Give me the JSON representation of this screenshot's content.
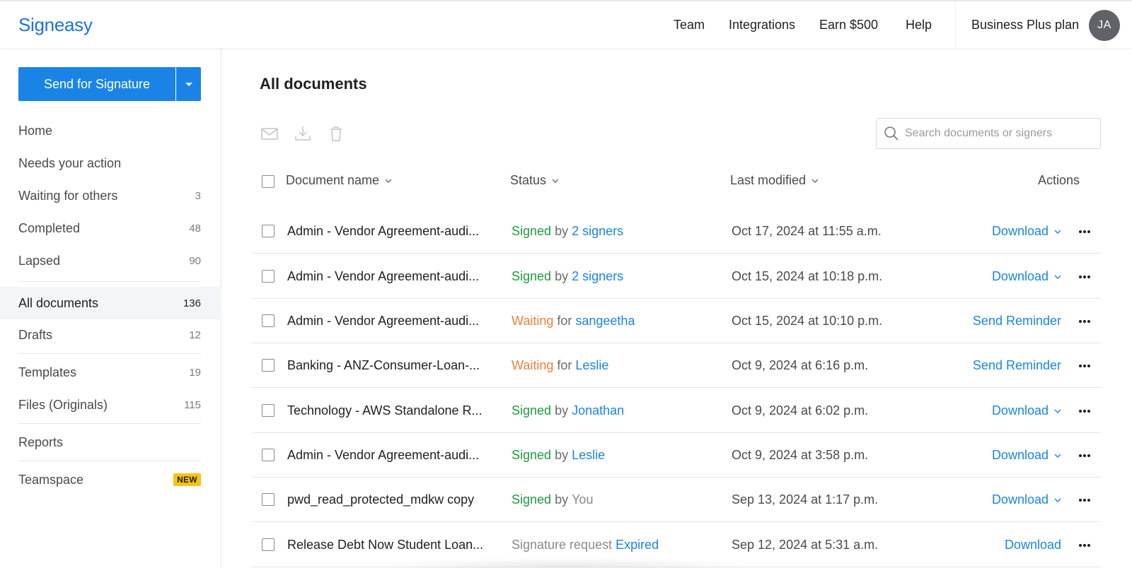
{
  "header": {
    "logo": "Signeasy",
    "nav": [
      {
        "label": "Team",
        "name": "nav-team"
      },
      {
        "label": "Integrations",
        "name": "nav-integrations"
      },
      {
        "label": "Earn $500",
        "name": "nav-earn"
      },
      {
        "label": "Help",
        "name": "nav-help"
      }
    ],
    "plan": "Business Plus plan",
    "avatar_initials": "JA"
  },
  "sidebar": {
    "send_label": "Send for Signature",
    "items": [
      {
        "label": "Home",
        "count": ""
      },
      {
        "label": "Needs your action",
        "count": ""
      },
      {
        "label": "Waiting for others",
        "count": "3"
      },
      {
        "label": "Completed",
        "count": "48"
      },
      {
        "label": "Lapsed",
        "count": "90"
      },
      {
        "label": "All documents",
        "count": "136",
        "active": true
      },
      {
        "label": "Drafts",
        "count": "12"
      },
      {
        "label": "Templates",
        "count": "19"
      },
      {
        "label": "Files (Originals)",
        "count": "115"
      },
      {
        "label": "Reports",
        "count": ""
      },
      {
        "label": "Teamspace",
        "badge": "NEW"
      }
    ]
  },
  "main": {
    "title": "All documents",
    "search_placeholder": "Search documents or signers",
    "columns": {
      "name": "Document name",
      "status": "Status",
      "modified": "Last modified",
      "actions": "Actions"
    },
    "rows": [
      {
        "name": "Admin - Vendor Agreement-audi...",
        "status_a": "Signed",
        "status_b": " by ",
        "status_c": "2 signers",
        "status_kind": "signed",
        "modified": "Oct 17, 2024 at 11:55 a.m.",
        "action": "Download",
        "action_menu": true
      },
      {
        "name": "Admin - Vendor Agreement-audi...",
        "status_a": "Signed",
        "status_b": " by ",
        "status_c": "2 signers",
        "status_kind": "signed",
        "modified": "Oct 15, 2024 at 10:18 p.m.",
        "action": "Download",
        "action_menu": true
      },
      {
        "name": "Admin - Vendor Agreement-audi...",
        "status_a": "Waiting",
        "status_b": " for ",
        "status_c": "sangeetha",
        "status_kind": "waiting",
        "modified": "Oct 15, 2024 at 10:10 p.m.",
        "action": "Send Reminder",
        "action_menu": false
      },
      {
        "name": "Banking - ANZ-Consumer-Loan-...",
        "status_a": "Waiting",
        "status_b": " for ",
        "status_c": "Leslie",
        "status_kind": "waiting",
        "modified": "Oct 9, 2024 at 6:16 p.m.",
        "action": "Send Reminder",
        "action_menu": false
      },
      {
        "name": "Technology - AWS Standalone R...",
        "status_a": "Signed",
        "status_b": " by ",
        "status_c": "Jonathan",
        "status_kind": "signed",
        "modified": "Oct 9, 2024 at 6:02 p.m.",
        "action": "Download",
        "action_menu": true
      },
      {
        "name": "Admin - Vendor Agreement-audi...",
        "status_a": "Signed",
        "status_b": " by ",
        "status_c": "Leslie",
        "status_kind": "signed",
        "modified": "Oct 9, 2024 at 3:58 p.m.",
        "action": "Download",
        "action_menu": true
      },
      {
        "name": "pwd_read_protected_mdkw copy",
        "status_a": "Signed",
        "status_b": " by ",
        "status_c": "You",
        "status_kind": "signed-you",
        "modified": "Sep 13, 2024 at 1:17 p.m.",
        "action": "Download",
        "action_menu": true
      },
      {
        "name": "Release Debt Now Student Loan...",
        "status_a": "Signature request",
        "status_b": " ",
        "status_c": "Expired",
        "status_kind": "expired",
        "modified": "Sep 12, 2024 at 5:31 a.m.",
        "action": "Download",
        "action_menu": false
      }
    ]
  },
  "colors": {
    "brand": "#1a73d9",
    "primary": "#1a84e6",
    "signed": "#1e9b3c",
    "waiting": "#f07f3c",
    "badge": "#f9c412"
  },
  "icons": [
    "email-icon",
    "download-icon",
    "trash-icon",
    "search-icon",
    "chevron-down-icon",
    "more-icon"
  ]
}
